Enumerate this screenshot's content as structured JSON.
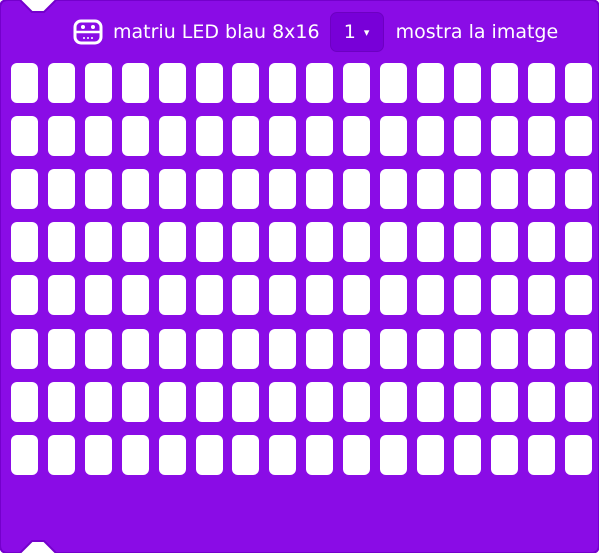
{
  "block": {
    "color": "#8a0ce6",
    "border_color": "#7400cc",
    "icon": "led-matrix-icon",
    "title": "matriu LED blau 8x16",
    "dropdown": {
      "selected": "1",
      "caret": "▾"
    },
    "action_label": "mostra la imatge",
    "matrix": {
      "rows": 8,
      "cols": 16,
      "led_color": "#ffffff"
    }
  }
}
